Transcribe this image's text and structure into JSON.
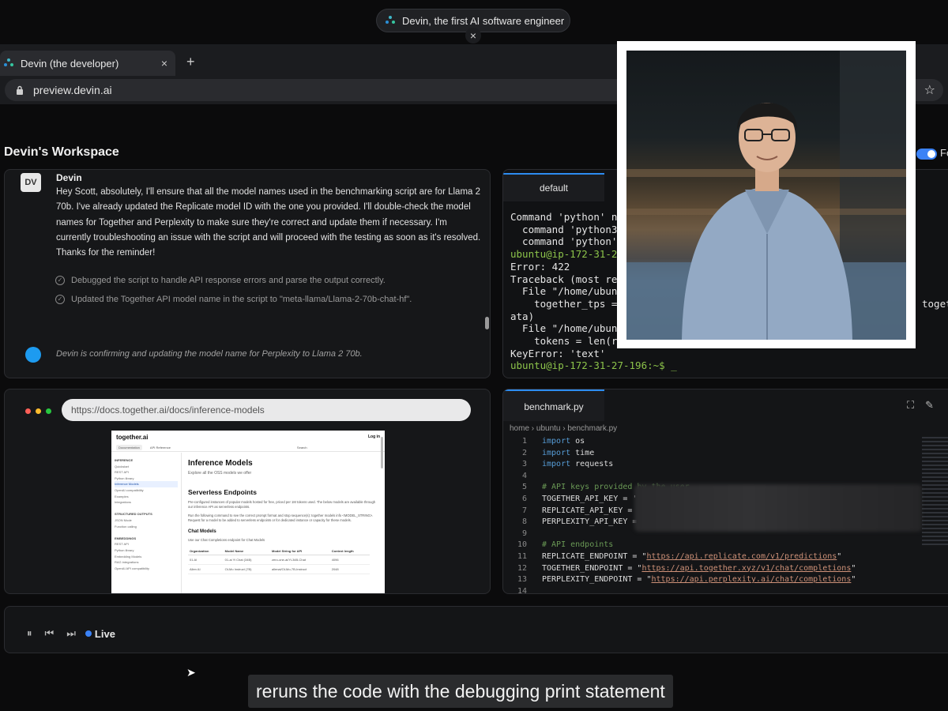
{
  "banner": {
    "text": "Devin, the first AI software engineer",
    "close": "×"
  },
  "browser": {
    "tab_title": "Devin (the developer)",
    "tab_close": "×",
    "new_tab": "+",
    "url": "preview.devin.ai",
    "star": "☆"
  },
  "workspace": {
    "title": "Devin's Workspace",
    "toggle_label": "Fo"
  },
  "chat": {
    "avatar": "DV",
    "sender": "Devin",
    "message": "Hey Scott, absolutely, I'll ensure that all the model names used in the benchmarking script are for Llama 2 70b. I've already updated the Replicate model ID with the one you provided. I'll double-check the model names for Together and Perplexity to make sure they're correct and update them if necessary. I'm currently troubleshooting an issue with the script and will proceed with the testing as soon as it's resolved. Thanks for the reminder!",
    "steps": [
      "Debugged the script to handle API response errors and parse the output correctly.",
      "Updated the Together API model name in the script to \"meta-llama/Llama-2-70b-chat-hf\"."
    ],
    "status": "Devin is confirming and updating the model name for Perplexity to Llama 2 70b."
  },
  "terminal": {
    "tab": "default",
    "lines": [
      "Command 'python' no",
      "  command 'python3",
      "  command 'python'",
      "ubuntu@ip-172-31-27",
      "Error: 422",
      "Traceback (most re",
      "  File \"/home/ubun",
      "    together_tps =",
      "ata)",
      "  File \"/home/ubun",
      "    tokens = len(r",
      "KeyError: 'text'",
      "ubuntu@ip-172-31-27-196:~$ _"
    ],
    "right_fragment": "toget"
  },
  "embedded_browser": {
    "url": "https://docs.together.ai/docs/inference-models",
    "doc": {
      "brand": "together.ai",
      "login": "Log in",
      "tabs": [
        "Documentation",
        "API Reference",
        "Search"
      ],
      "sidebar": [
        {
          "text": "INFERENCE",
          "style": "h"
        },
        {
          "text": "Quickstart",
          "style": ""
        },
        {
          "text": "REST API",
          "style": ""
        },
        {
          "text": "Python library",
          "style": ""
        },
        {
          "text": "Inference Models",
          "style": "sel"
        },
        {
          "text": "OpenAI compatibility",
          "style": ""
        },
        {
          "text": "Examples",
          "style": ""
        },
        {
          "text": "Integrations",
          "style": ""
        },
        {
          "text": "",
          "style": ""
        },
        {
          "text": "STRUCTURED OUTPUTS",
          "style": "h"
        },
        {
          "text": "JSON Mode",
          "style": ""
        },
        {
          "text": "Function calling",
          "style": ""
        },
        {
          "text": "",
          "style": ""
        },
        {
          "text": "EMBEDDINGS",
          "style": "h"
        },
        {
          "text": "REST API",
          "style": ""
        },
        {
          "text": "Python library",
          "style": ""
        },
        {
          "text": "Embedding Models",
          "style": ""
        },
        {
          "text": "RAG integrations",
          "style": ""
        },
        {
          "text": "OpenAI API compatibility",
          "style": ""
        }
      ],
      "h1": "Inference Models",
      "lead": "Explore all the OSS models we offer",
      "h2": "Serverless Endpoints",
      "p1": "Pre-configured instances of popular models hosted for free, priced per 1M tokens used. The below models are available through our inference API as serverless endpoints.",
      "p2": "Run the following command to see the correct prompt format and stop sequence(s): together models info <MODEL_STRING>. Request for a model to be added to serverless endpoints or for dedicated instance or capacity for these models.",
      "h3": "Chat Models",
      "p3": "Use our Chat Completions endpoint for Chat Models",
      "table_headers": [
        "Organization",
        "Model Name",
        "Model String for API",
        "Context length"
      ],
      "table_rows": [
        [
          "01.AI",
          "01-ai Yi Chat (34B)",
          "zero-one-ai/Yi-34B-Chat",
          "4096"
        ],
        [
          "Allen AI",
          "OLMo Instruct (7B)",
          "allenai/OLMo-7B-Instruct",
          "2048"
        ]
      ]
    }
  },
  "editor": {
    "tab": "benchmark.py",
    "icons": [
      "⛶",
      "✎"
    ],
    "breadcrumb": "home › ubuntu › benchmark.py",
    "line_numbers": [
      "1",
      "2",
      "3",
      "4",
      "5",
      "6",
      "7",
      "8",
      "9",
      "10",
      "11",
      "12",
      "13",
      "14"
    ]
  },
  "playback": {
    "controls": [
      "⏸",
      "⏮",
      "⏭"
    ],
    "live": "Live"
  },
  "caption": "reruns the code with the debugging print statement"
}
